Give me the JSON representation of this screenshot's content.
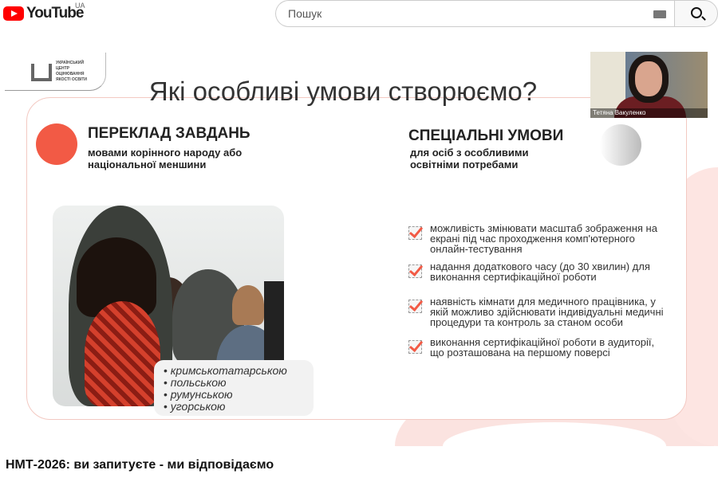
{
  "header": {
    "logo_text": "YouTube",
    "region": "UA",
    "search_placeholder": "Пошук"
  },
  "slide": {
    "logo_text": [
      "УКРАЇНСЬКИЙ",
      "ЦЕНТР",
      "ОЦІНЮВАННЯ",
      "ЯКОСТІ ОСВІТИ"
    ],
    "title": "Які особливі умови створюємо?",
    "left": {
      "heading": "ПЕРЕКЛАД ЗАВДАНЬ",
      "subheading": [
        "мовами корінного народу або",
        "національної меншини"
      ],
      "languages": [
        "кримськотатарською",
        "польською",
        "румунською",
        "угорською"
      ]
    },
    "right": {
      "heading": "СПЕЦІАЛЬНІ УМОВИ",
      "subheading": [
        "для осіб з особливими",
        "освітніми потребами"
      ],
      "items": [
        "можливість змінювати масштаб зображення на екрані під час проходження комп'ютерного онлайн-тестування",
        "надання додаткового часу (до 30 хвилин) для виконання сертифікаційної роботи",
        "наявність кімнати для медичного працівника, у якій можливо здійснювати індивідуальні медичні процедури та контроль за станом особи",
        "виконання сертифікаційної роботи в аудиторії, що розташована на першому поверсі"
      ]
    },
    "accent": "#f25a45"
  },
  "webcam": {
    "name": "Тетяна Вакуленко"
  },
  "video": {
    "title": "НМТ-2026: ви запитуєте - ми відповідаємо"
  }
}
